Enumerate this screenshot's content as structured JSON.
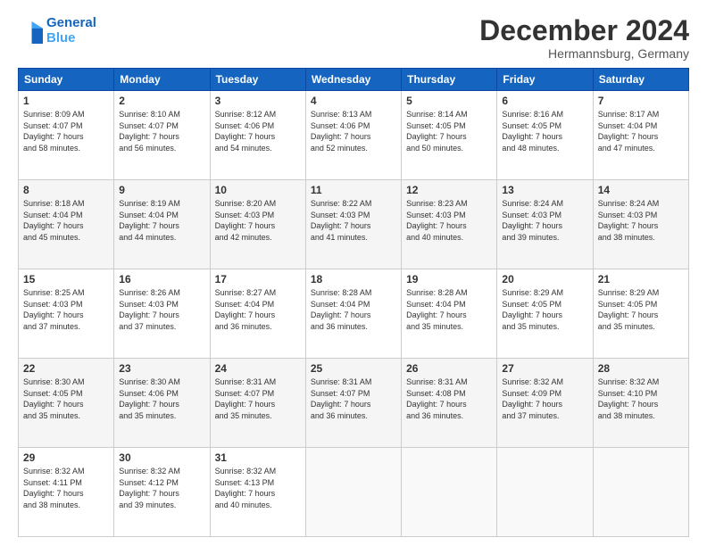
{
  "header": {
    "logo_line1": "General",
    "logo_line2": "Blue",
    "month": "December 2024",
    "location": "Hermannsburg, Germany"
  },
  "days_of_week": [
    "Sunday",
    "Monday",
    "Tuesday",
    "Wednesday",
    "Thursday",
    "Friday",
    "Saturday"
  ],
  "weeks": [
    [
      {
        "day": "1",
        "sunrise": "8:09 AM",
        "sunset": "4:07 PM",
        "daylight": "7 hours and 58 minutes."
      },
      {
        "day": "2",
        "sunrise": "8:10 AM",
        "sunset": "4:07 PM",
        "daylight": "7 hours and 56 minutes."
      },
      {
        "day": "3",
        "sunrise": "8:12 AM",
        "sunset": "4:06 PM",
        "daylight": "7 hours and 54 minutes."
      },
      {
        "day": "4",
        "sunrise": "8:13 AM",
        "sunset": "4:06 PM",
        "daylight": "7 hours and 52 minutes."
      },
      {
        "day": "5",
        "sunrise": "8:14 AM",
        "sunset": "4:05 PM",
        "daylight": "7 hours and 50 minutes."
      },
      {
        "day": "6",
        "sunrise": "8:16 AM",
        "sunset": "4:05 PM",
        "daylight": "7 hours and 48 minutes."
      },
      {
        "day": "7",
        "sunrise": "8:17 AM",
        "sunset": "4:04 PM",
        "daylight": "7 hours and 47 minutes."
      }
    ],
    [
      {
        "day": "8",
        "sunrise": "8:18 AM",
        "sunset": "4:04 PM",
        "daylight": "7 hours and 45 minutes."
      },
      {
        "day": "9",
        "sunrise": "8:19 AM",
        "sunset": "4:04 PM",
        "daylight": "7 hours and 44 minutes."
      },
      {
        "day": "10",
        "sunrise": "8:20 AM",
        "sunset": "4:03 PM",
        "daylight": "7 hours and 42 minutes."
      },
      {
        "day": "11",
        "sunrise": "8:22 AM",
        "sunset": "4:03 PM",
        "daylight": "7 hours and 41 minutes."
      },
      {
        "day": "12",
        "sunrise": "8:23 AM",
        "sunset": "4:03 PM",
        "daylight": "7 hours and 40 minutes."
      },
      {
        "day": "13",
        "sunrise": "8:24 AM",
        "sunset": "4:03 PM",
        "daylight": "7 hours and 39 minutes."
      },
      {
        "day": "14",
        "sunrise": "8:24 AM",
        "sunset": "4:03 PM",
        "daylight": "7 hours and 38 minutes."
      }
    ],
    [
      {
        "day": "15",
        "sunrise": "8:25 AM",
        "sunset": "4:03 PM",
        "daylight": "7 hours and 37 minutes."
      },
      {
        "day": "16",
        "sunrise": "8:26 AM",
        "sunset": "4:03 PM",
        "daylight": "7 hours and 37 minutes."
      },
      {
        "day": "17",
        "sunrise": "8:27 AM",
        "sunset": "4:04 PM",
        "daylight": "7 hours and 36 minutes."
      },
      {
        "day": "18",
        "sunrise": "8:28 AM",
        "sunset": "4:04 PM",
        "daylight": "7 hours and 36 minutes."
      },
      {
        "day": "19",
        "sunrise": "8:28 AM",
        "sunset": "4:04 PM",
        "daylight": "7 hours and 35 minutes."
      },
      {
        "day": "20",
        "sunrise": "8:29 AM",
        "sunset": "4:05 PM",
        "daylight": "7 hours and 35 minutes."
      },
      {
        "day": "21",
        "sunrise": "8:29 AM",
        "sunset": "4:05 PM",
        "daylight": "7 hours and 35 minutes."
      }
    ],
    [
      {
        "day": "22",
        "sunrise": "8:30 AM",
        "sunset": "4:05 PM",
        "daylight": "7 hours and 35 minutes."
      },
      {
        "day": "23",
        "sunrise": "8:30 AM",
        "sunset": "4:06 PM",
        "daylight": "7 hours and 35 minutes."
      },
      {
        "day": "24",
        "sunrise": "8:31 AM",
        "sunset": "4:07 PM",
        "daylight": "7 hours and 35 minutes."
      },
      {
        "day": "25",
        "sunrise": "8:31 AM",
        "sunset": "4:07 PM",
        "daylight": "7 hours and 36 minutes."
      },
      {
        "day": "26",
        "sunrise": "8:31 AM",
        "sunset": "4:08 PM",
        "daylight": "7 hours and 36 minutes."
      },
      {
        "day": "27",
        "sunrise": "8:32 AM",
        "sunset": "4:09 PM",
        "daylight": "7 hours and 37 minutes."
      },
      {
        "day": "28",
        "sunrise": "8:32 AM",
        "sunset": "4:10 PM",
        "daylight": "7 hours and 38 minutes."
      }
    ],
    [
      {
        "day": "29",
        "sunrise": "8:32 AM",
        "sunset": "4:11 PM",
        "daylight": "7 hours and 38 minutes."
      },
      {
        "day": "30",
        "sunrise": "8:32 AM",
        "sunset": "4:12 PM",
        "daylight": "7 hours and 39 minutes."
      },
      {
        "day": "31",
        "sunrise": "8:32 AM",
        "sunset": "4:13 PM",
        "daylight": "7 hours and 40 minutes."
      },
      null,
      null,
      null,
      null
    ]
  ],
  "labels": {
    "sunrise": "Sunrise: ",
    "sunset": "Sunset: ",
    "daylight": "Daylight: "
  }
}
